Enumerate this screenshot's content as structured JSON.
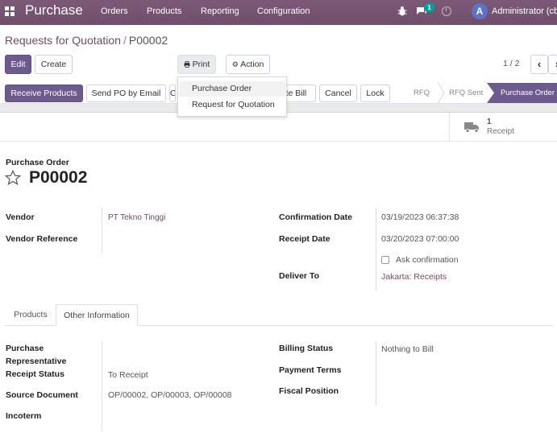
{
  "navbar": {
    "brand": "Purchase",
    "menu": [
      "Orders",
      "Products",
      "Reporting",
      "Configuration"
    ],
    "chat_badge": "1",
    "avatar_letter": "A",
    "user": "Administrator (cb(",
    "bg_color": "#714b67"
  },
  "breadcrumb": {
    "parent": "Requests for Quotation",
    "separator": "/",
    "current": "P00002"
  },
  "toolbar": {
    "edit": "Edit",
    "create": "Create",
    "print": "Print",
    "action": "Action",
    "pager": "1 / 2"
  },
  "print_menu": {
    "items": [
      "Purchase Order",
      "Request for Quotation"
    ]
  },
  "statusbar": {
    "buttons": {
      "receive": "Receive Products",
      "send_po": "Send PO by Email",
      "c": "C",
      "bill": "ate Bill",
      "cancel": "Cancel",
      "lock": "Lock"
    },
    "stages": [
      "RFQ",
      "RFQ Sent",
      "Purchase Order"
    ],
    "active_stage": "Purchase Order"
  },
  "smart_button": {
    "count": "1",
    "label": "Receipt"
  },
  "form": {
    "record_type": "Purchase Order",
    "number": "P00002",
    "left": {
      "vendor_label": "Vendor",
      "vendor_value": "PT Tekno Tinggi",
      "vendor_ref_label": "Vendor Reference",
      "vendor_ref_value": ""
    },
    "right": {
      "confirmation_label": "Confirmation Date",
      "confirmation_value": "03/19/2023 06:37:38",
      "receipt_label": "Receipt Date",
      "receipt_value": "03/20/2023 07:00:00",
      "ask_confirmation": "Ask confirmation",
      "deliver_label": "Deliver To",
      "deliver_value": "Jakarta: Receipts"
    }
  },
  "tabs": [
    "Products",
    "Other Information"
  ],
  "active_tab": "Other Information",
  "other_info": {
    "left": {
      "rep_label_1": "Purchase",
      "rep_label_2": "Representative",
      "receipt_status_label": "Receipt Status",
      "receipt_status_value": "To Receipt",
      "source_label": "Source Document",
      "source_value": "OP/00002, OP/00003, OP/00008",
      "incoterm_label": "Incoterm"
    },
    "right": {
      "billing_label": "Billing Status",
      "billing_value": "Nothing to Bill",
      "payment_label": "Payment Terms",
      "fiscal_label": "Fiscal Position"
    }
  }
}
